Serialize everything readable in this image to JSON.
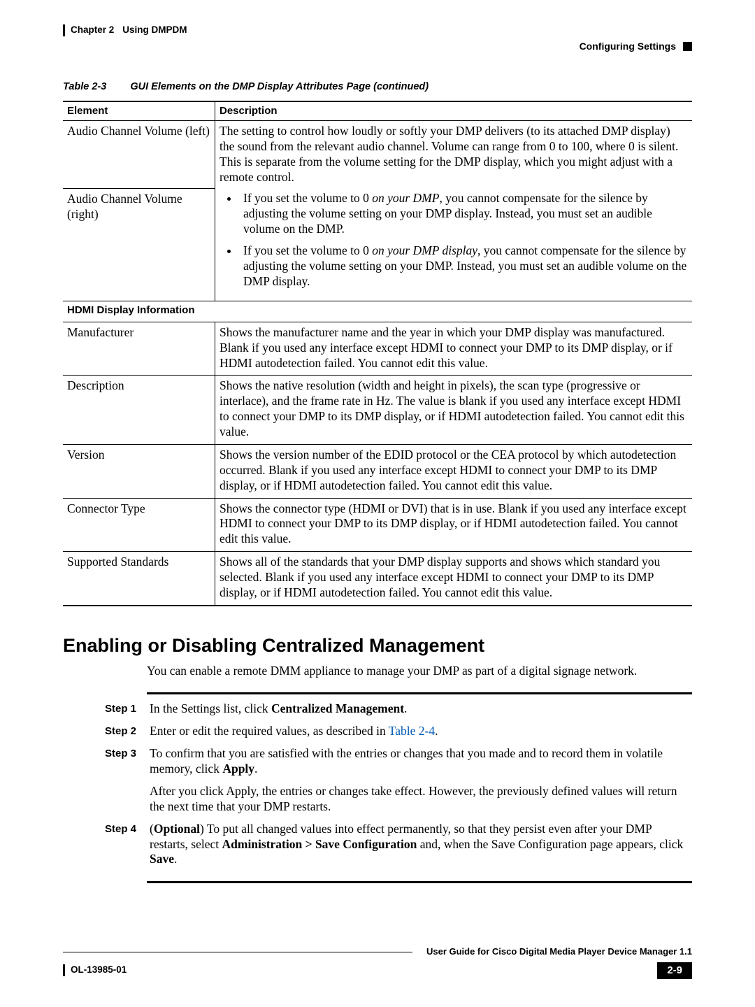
{
  "header": {
    "chapter": "Chapter 2",
    "chapter_title": "Using DMPDM",
    "section": "Configuring Settings"
  },
  "table": {
    "label": "Table 2-3",
    "title": "GUI Elements on the DMP Display Attributes Page (continued)",
    "columns": {
      "element": "Element",
      "description": "Description"
    },
    "audio": {
      "row1_label": "Audio Channel Volume (left)",
      "row2_label": "Audio Channel Volume (right)",
      "desc_main": "The setting to control how loudly or softly your DMP delivers (to its attached DMP display) the sound from the relevant audio channel. Volume can range from 0 to 100, where 0 is silent. This is separate from the volume setting for the DMP display, which you might adjust with a remote control.",
      "bullet1_a": "If you set the volume to 0 ",
      "bullet1_em": "on your DMP",
      "bullet1_b": ", you cannot compensate for the silence by adjusting the volume setting on your DMP display. Instead, you must set an audible volume on the DMP.",
      "bullet2_a": "If you set the volume to 0 ",
      "bullet2_em": "on your DMP display",
      "bullet2_b": ", you cannot compensate for the silence by adjusting the volume setting on your DMP. Instead, you must set an audible volume on the DMP display."
    },
    "section_hdmi": "HDMI Display Information",
    "rows": [
      {
        "el": "Manufacturer",
        "desc": "Shows the manufacturer name and the year in which your DMP display was manufactured. Blank if you used any interface except HDMI to connect your DMP to its DMP display, or if HDMI autodetection failed. You cannot edit this value."
      },
      {
        "el": "Description",
        "desc": "Shows the native resolution (width and height in pixels), the scan type (progressive or interlace), and the frame rate in Hz. The value is blank if you used any interface except HDMI to connect your DMP to its DMP display, or if HDMI autodetection failed. You cannot edit this value."
      },
      {
        "el": "Version",
        "desc": "Shows the version number of the EDID protocol or the CEA protocol by which autodetection occurred. Blank if you used any interface except HDMI to connect your DMP to its DMP display, or if HDMI autodetection failed. You cannot edit this value."
      },
      {
        "el": "Connector Type",
        "desc": "Shows the connector type (HDMI or DVI) that is in use. Blank if you used any interface except HDMI to connect your DMP to its DMP display, or if HDMI autodetection failed. You cannot edit this value."
      },
      {
        "el": "Supported Standards",
        "desc": "Shows all of the standards that your DMP display supports and shows which standard you selected. Blank if you used any interface except HDMI to connect your DMP to its DMP display, or if HDMI autodetection failed. You cannot edit this value."
      }
    ]
  },
  "section": {
    "heading": "Enabling or Disabling Centralized Management",
    "intro": "You can enable a remote DMM appliance to manage your DMP as part of a digital signage network.",
    "steps": [
      {
        "label": "Step 1",
        "pre": "In the Settings list, click ",
        "bold": "Centralized Management",
        "post": "."
      },
      {
        "label": "Step 2",
        "pre": "Enter or edit the required values, as described in ",
        "link": "Table 2-4",
        "post": "."
      },
      {
        "label": "Step 3",
        "pre": "To confirm that you are satisfied with the entries or changes that you made and to record them in volatile memory, click ",
        "bold": "Apply",
        "post": ".",
        "extra": "After you click Apply, the entries or changes take effect. However, the previously defined values will return the next time that your DMP restarts."
      },
      {
        "label": "Step 4",
        "optpre": "(",
        "opt": "Optional",
        "optpost": ") To put all changed values into effect permanently, so that they persist even after your DMP restarts, select ",
        "bold": "Administration > Save Configuration",
        "post2": " and, when the Save Configuration page appears, click ",
        "bold2": "Save",
        "post3": "."
      }
    ]
  },
  "footer": {
    "doc_title": "User Guide for Cisco Digital Media Player Device Manager 1.1",
    "doc_id": "OL-13985-01",
    "page": "2-9"
  }
}
